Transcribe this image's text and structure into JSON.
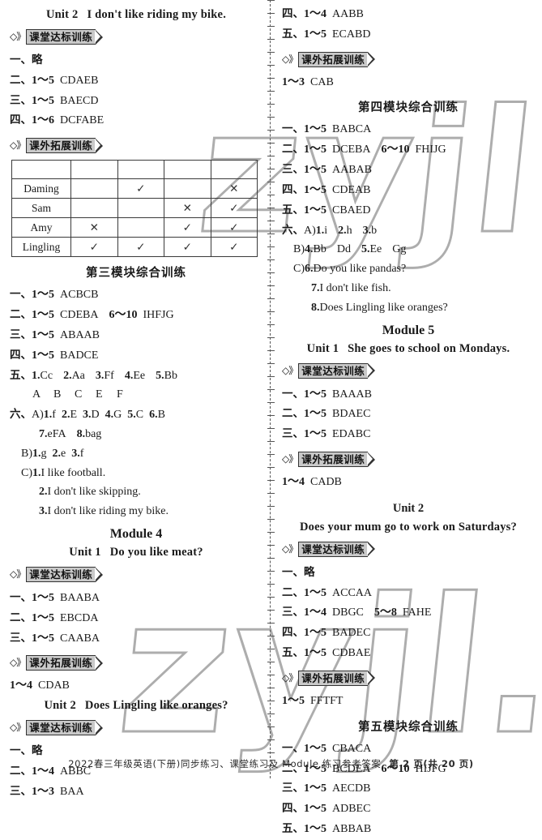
{
  "footer": {
    "text": "2022春三年级英语(下册)同步练习、课堂练习及 Module 练习参考答案",
    "page": "第 2 页(共 20 页)"
  },
  "watermark": {
    "text": "zyjl."
  },
  "badges": {
    "classroom": "课堂达标训练",
    "extension": "课外拓展训练",
    "glyph": "◇》"
  },
  "left_column": {
    "unit2_title_a": "Unit 2",
    "unit2_title_b": "I don't like riding my bike.",
    "m3u2_classroom": [
      {
        "num": "一、",
        "body": "略",
        "cn": true
      },
      {
        "num": "二、",
        "range": "1～5",
        "ans": "CDAEB"
      },
      {
        "num": "三、",
        "range": "1～5",
        "ans": "BAECD"
      },
      {
        "num": "四、",
        "range": "1～6",
        "ans": "DCFABE"
      }
    ],
    "table": {
      "header": [
        "",
        "",
        "",
        "",
        ""
      ],
      "rows": [
        {
          "name": "Daming",
          "cells": [
            "",
            "✓",
            "",
            "✕"
          ]
        },
        {
          "name": "Sam",
          "cells": [
            "",
            "",
            "✕",
            "✓"
          ]
        },
        {
          "name": "Amy",
          "cells": [
            "✕",
            "",
            "✓",
            "✓"
          ]
        },
        {
          "name": "Lingling",
          "cells": [
            "✓",
            "✓",
            "✓",
            "✓"
          ]
        }
      ]
    },
    "module3_综合": "第三模块综合训练",
    "m3_comprehensive": [
      {
        "num": "一、",
        "range": "1～5",
        "ans": "ACBCB"
      },
      {
        "num": "二、",
        "range": "1～5",
        "ans": "CDEBA",
        "range2": "6～10",
        "ans2": "IHFJG"
      },
      {
        "num": "三、",
        "range": "1～5",
        "ans": "ABAAB"
      },
      {
        "num": "四、",
        "range": "1～5",
        "ans": "BADCE"
      }
    ],
    "m3_five": {
      "num": "五、",
      "items": [
        {
          "n": "1.",
          "v": "Cc"
        },
        {
          "n": "2.",
          "v": "Aa"
        },
        {
          "n": "3.",
          "v": "Ff"
        },
        {
          "n": "4.",
          "v": "Ee"
        },
        {
          "n": "5.",
          "v": "Bb"
        }
      ],
      "letters": [
        "A",
        "B",
        "C",
        "E",
        "F"
      ]
    },
    "m3_six": {
      "num": "六、",
      "partA_label": "A)",
      "partA": [
        {
          "n": "1.",
          "v": "f"
        },
        {
          "n": "2.",
          "v": "E"
        },
        {
          "n": "3.",
          "v": "D"
        },
        {
          "n": "4.",
          "v": "G"
        },
        {
          "n": "5.",
          "v": "C"
        },
        {
          "n": "6.",
          "v": "B"
        }
      ],
      "partA2": [
        {
          "n": "7.",
          "v": "eFA"
        },
        {
          "n": "8.",
          "v": "bag"
        }
      ],
      "partB_label": "B)",
      "partB": [
        {
          "n": "1.",
          "v": "g"
        },
        {
          "n": "2.",
          "v": "e"
        },
        {
          "n": "3.",
          "v": "f"
        }
      ],
      "partC_label": "C)",
      "partC": [
        {
          "n": "1.",
          "v": "I like football."
        },
        {
          "n": "2.",
          "v": "I don't like skipping."
        },
        {
          "n": "3.",
          "v": "I don't like riding my bike."
        }
      ]
    },
    "module4_title": "Module 4",
    "m4u1_title_a": "Unit 1",
    "m4u1_title_b": "Do you like meat?",
    "m4u1_classroom": [
      {
        "num": "一、",
        "range": "1～5",
        "ans": "BAABA"
      },
      {
        "num": "二、",
        "range": "1～5",
        "ans": "EBCDA"
      },
      {
        "num": "三、",
        "range": "1～5",
        "ans": "CAABA"
      }
    ],
    "m4u1_extension": {
      "range": "1～4",
      "ans": "CDAB"
    },
    "m4u2_title_a": "Unit 2",
    "m4u2_title_b": "Does Lingling like oranges?",
    "m4u2_classroom": [
      {
        "num": "一、",
        "body": "略",
        "cn": true
      },
      {
        "num": "二、",
        "range": "1～4",
        "ans": "ABBC"
      },
      {
        "num": "三、",
        "range": "1～3",
        "ans": "BAA"
      }
    ]
  },
  "right_column": {
    "m4u2_classroom_cont": [
      {
        "num": "四、",
        "range": "1～4",
        "ans": "AABB"
      },
      {
        "num": "五、",
        "range": "1～5",
        "ans": "ECABD"
      }
    ],
    "m4u2_extension": {
      "range": "1～3",
      "ans": "CAB"
    },
    "module4_综合": "第四模块综合训练",
    "m4_comprehensive": [
      {
        "num": "一、",
        "range": "1～5",
        "ans": "BABCA"
      },
      {
        "num": "二、",
        "range": "1～5",
        "ans": "DCEBA",
        "range2": "6～10",
        "ans2": "FHIJG"
      },
      {
        "num": "三、",
        "range": "1～5",
        "ans": "AABAB"
      },
      {
        "num": "四、",
        "range": "1～5",
        "ans": "CDEAB"
      },
      {
        "num": "五、",
        "range": "1～5",
        "ans": "CBAED"
      }
    ],
    "m4_six": {
      "num": "六、",
      "partA_label": "A)",
      "partA": [
        {
          "n": "1.",
          "v": "i"
        },
        {
          "n": "2.",
          "v": "h"
        },
        {
          "n": "3.",
          "v": "b"
        }
      ],
      "partB_label": "B)",
      "partB": [
        {
          "n": "4.",
          "v": "Bb"
        },
        {
          "n": "",
          "v": "Dd"
        },
        {
          "n": "5.",
          "v": "Ee"
        },
        {
          "n": "",
          "v": "Gg"
        }
      ],
      "partC_label": "C)",
      "partC": [
        {
          "n": "6.",
          "v": "Do you like pandas?"
        },
        {
          "n": "7.",
          "v": "I don't like fish."
        },
        {
          "n": "8.",
          "v": "Does Lingling like oranges?"
        }
      ]
    },
    "module5_title": "Module 5",
    "m5u1_title_a": "Unit 1",
    "m5u1_title_b": "She goes to school on Mondays.",
    "m5u1_classroom": [
      {
        "num": "一、",
        "range": "1～5",
        "ans": "BAAAB"
      },
      {
        "num": "二、",
        "range": "1～5",
        "ans": "BDAEC"
      },
      {
        "num": "三、",
        "range": "1～5",
        "ans": "EDABC"
      }
    ],
    "m5u1_extension": {
      "range": "1～4",
      "ans": "CADB"
    },
    "m5u2_title_a": "Unit 2",
    "m5u2_title_b": "Does your mum go to work on Saturdays?",
    "m5u2_classroom": [
      {
        "num": "一、",
        "body": "略",
        "cn": true
      },
      {
        "num": "二、",
        "range": "1～5",
        "ans": "ACCAA"
      },
      {
        "num": "三、",
        "range": "1～4",
        "ans": "DBGC",
        "range2": "5～8",
        "ans2": "FAHE"
      },
      {
        "num": "四、",
        "range": "1～5",
        "ans": "BADEC"
      },
      {
        "num": "五、",
        "range": "1～5",
        "ans": "CDBAE"
      }
    ],
    "m5u2_extension": {
      "range": "1～5",
      "ans": "FFTFT"
    },
    "module5_综合": "第五模块综合训练",
    "m5_comprehensive": [
      {
        "num": "一、",
        "range": "1～5",
        "ans": "CBACA"
      },
      {
        "num": "二、",
        "range": "1～5",
        "ans": "BCDEA",
        "range2": "6～10",
        "ans2": "HIJFG"
      },
      {
        "num": "三、",
        "range": "1～5",
        "ans": "AECDB"
      },
      {
        "num": "四、",
        "range": "1～5",
        "ans": "ADBEC"
      },
      {
        "num": "五、",
        "range": "1～5",
        "ans": "ABBAB"
      }
    ]
  }
}
